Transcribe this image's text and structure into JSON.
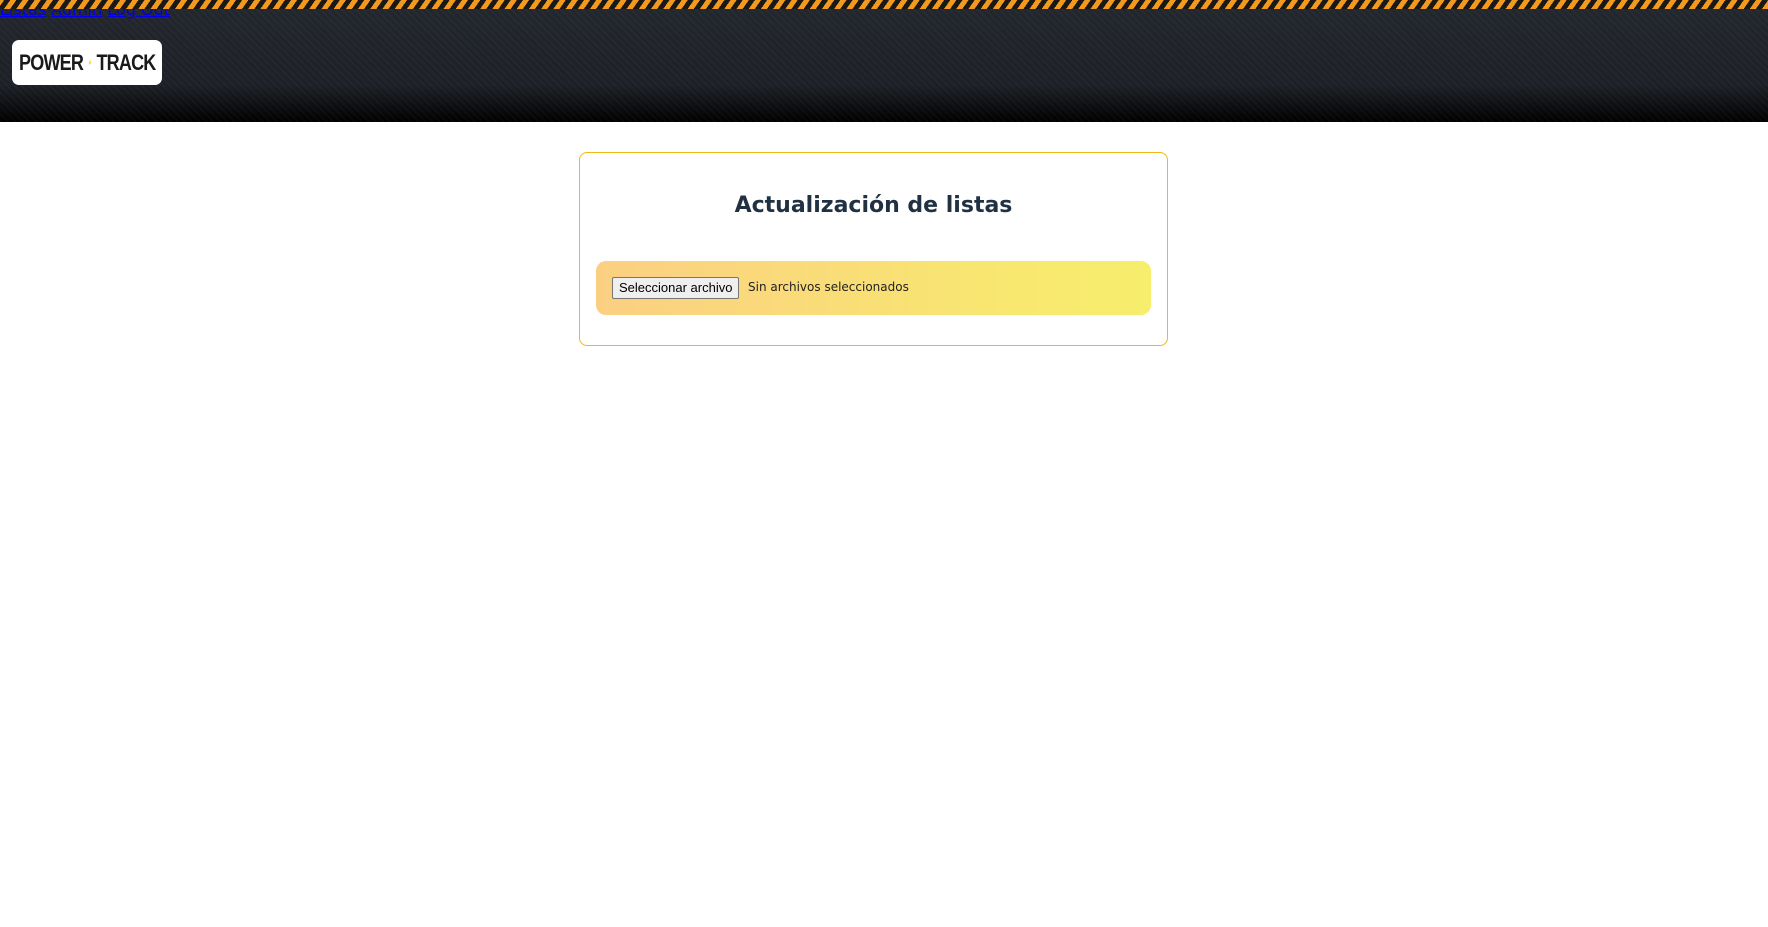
{
  "brand": {
    "logo_left": "POWER",
    "logo_right": "TRACK",
    "logo_bolt_icon": "lightning-bolt-icon",
    "bolt_color": "#f5c61a"
  },
  "nav": {
    "items": [
      {
        "label": "Listas"
      },
      {
        "label": "Admin"
      },
      {
        "label": "Log Out"
      }
    ],
    "color": "#f2a11d"
  },
  "main": {
    "title": "Actualización de listas",
    "upload": {
      "button_label": "Seleccionar archivo",
      "status": "Sin archivos seleccionados"
    },
    "accent_border": "#f0b915"
  }
}
